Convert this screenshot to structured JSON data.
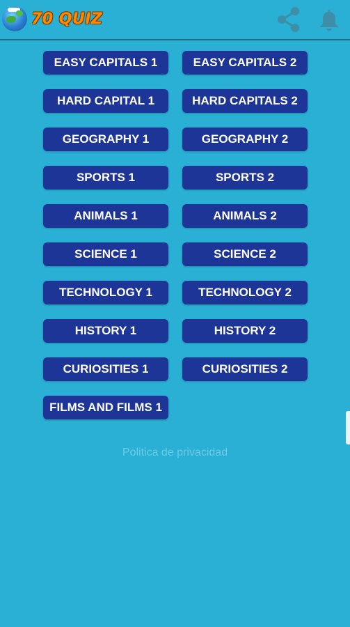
{
  "app_bar": {
    "title": "70 QUIZ",
    "icons": {
      "logo": "globe-logo-icon",
      "share": "share-icon",
      "notifications": "bell-icon"
    }
  },
  "quizzes": {
    "easy_capitals_1": "EASY CAPITALS 1",
    "easy_capitals_2": "EASY CAPITALS 2",
    "hard_capital_1": "HARD CAPITAL 1",
    "hard_capitals_2": "HARD CAPITALS 2",
    "geography_1": "GEOGRAPHY 1",
    "geography_2": "GEOGRAPHY 2",
    "sports_1": "SPORTS 1",
    "sports_2": "SPORTS 2",
    "animals_1": "ANIMALS 1",
    "animals_2": "ANIMALS 2",
    "science_1": "SCIENCE 1",
    "science_2": "SCIENCE 2",
    "technology_1": "TECHNOLOGY 1",
    "technology_2": "TECHNOLOGY 2",
    "history_1": "HISTORY 1",
    "history_2": "HISTORY 2",
    "curiosities_1": "CURIOSITIES 1",
    "curiosities_2": "CURIOSITIES 2",
    "films_and_films_1": "FILMS AND FILMS 1"
  },
  "footer": {
    "note": "Politica de privacidad"
  },
  "colors": {
    "background": "#29b0d4",
    "button": "#1e3598",
    "title": "#ff8a00"
  }
}
